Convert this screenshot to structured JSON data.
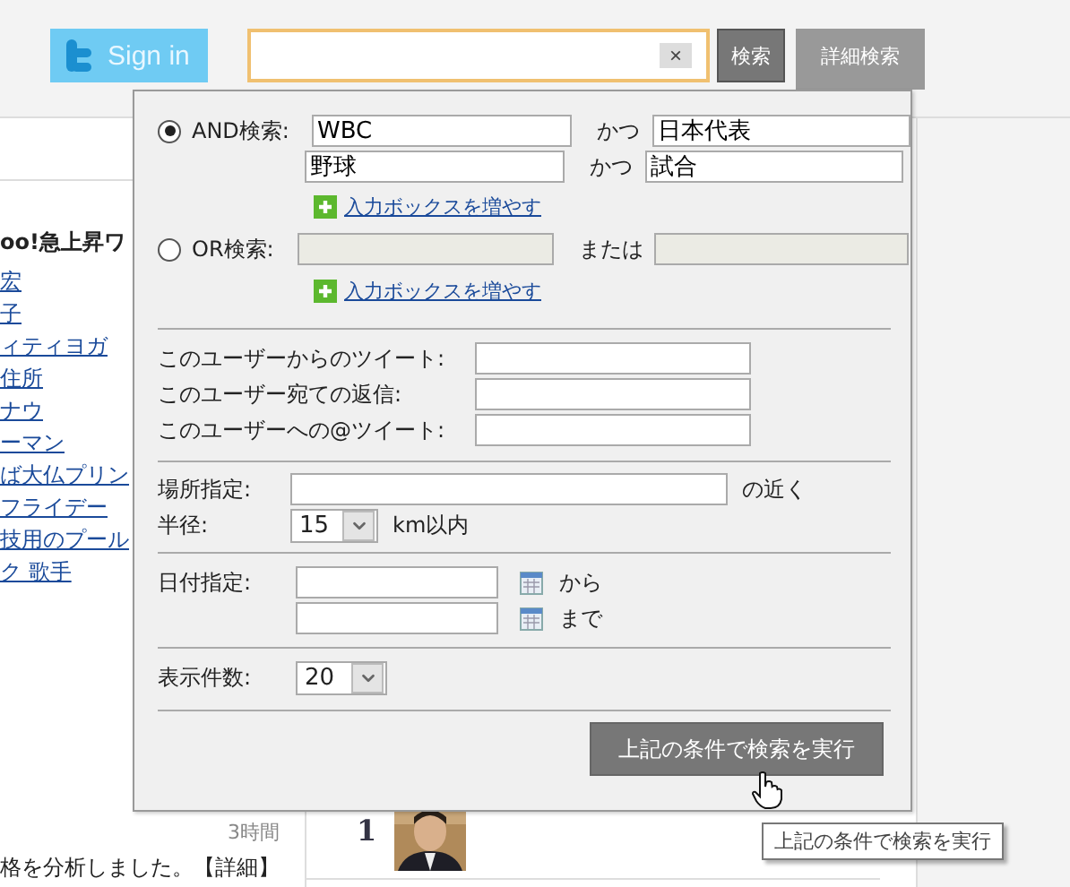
{
  "header": {
    "sign_in": "Sign in",
    "search": {
      "clear": "×"
    },
    "search_button": "検索",
    "advanced_tab": {
      "label": "詳細検索",
      "selected": true
    }
  },
  "sidebar": {
    "heading": "oo!急上昇ワ",
    "links": [
      "宏",
      "子",
      "ィティヨガ",
      "住所",
      "ナウ",
      "ーマン",
      "ば大仏プリン",
      "フライデー",
      "技用のプール",
      "ク 歌手"
    ]
  },
  "feed": {
    "time": "3時間",
    "text": "格を分析しました。【詳細】",
    "rank": "1"
  },
  "advanced_search": {
    "modes": [
      {
        "label": "AND検索:",
        "selected": true,
        "disabled": false,
        "rows": [
          {
            "left": "WBC",
            "joiner": "かつ",
            "right": "日本代表"
          },
          {
            "left": "野球",
            "joiner": "かつ",
            "right": "試合"
          }
        ],
        "add_link": "入力ボックスを増やす"
      },
      {
        "label": "OR検索:",
        "selected": false,
        "disabled": true,
        "rows": [
          {
            "joiner": "または"
          }
        ],
        "add_link": "入力ボックスを増やす"
      }
    ],
    "user_fields": [
      {
        "label": "このユーザーからのツイート:"
      },
      {
        "label": "このユーザー宛ての返信:"
      },
      {
        "label": "このユーザーへの@ツイート:"
      }
    ],
    "location": {
      "label": "場所指定:",
      "suffix": "の近く",
      "radius_label": "半径:",
      "radius": "15",
      "radius_unit": "km以内"
    },
    "date": {
      "label": "日付指定:",
      "from": "から",
      "to": "まで"
    },
    "count": {
      "label": "表示件数:",
      "value": "20"
    },
    "submit": "上記の条件で検索を実行"
  },
  "tooltip": "上記の条件で検索を実行"
}
